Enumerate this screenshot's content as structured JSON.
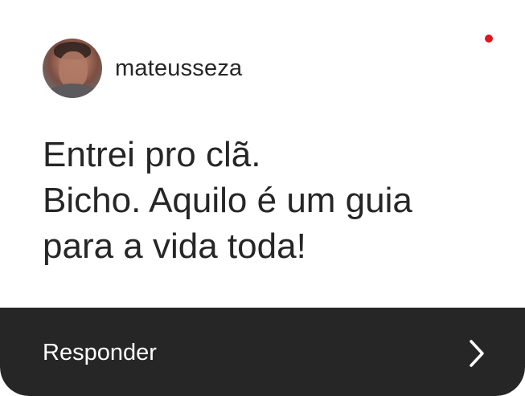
{
  "header": {
    "username": "mateusseza",
    "avatar_icon": "user-avatar-photo",
    "notification_color": "#e0151e"
  },
  "message": {
    "lines": [
      "Entrei pro clã.",
      "Bicho. Aquilo é um guia",
      "para a vida toda!"
    ]
  },
  "reply_bar": {
    "label": "Responder",
    "icon": "chevron-right-icon",
    "background": "#262626"
  }
}
